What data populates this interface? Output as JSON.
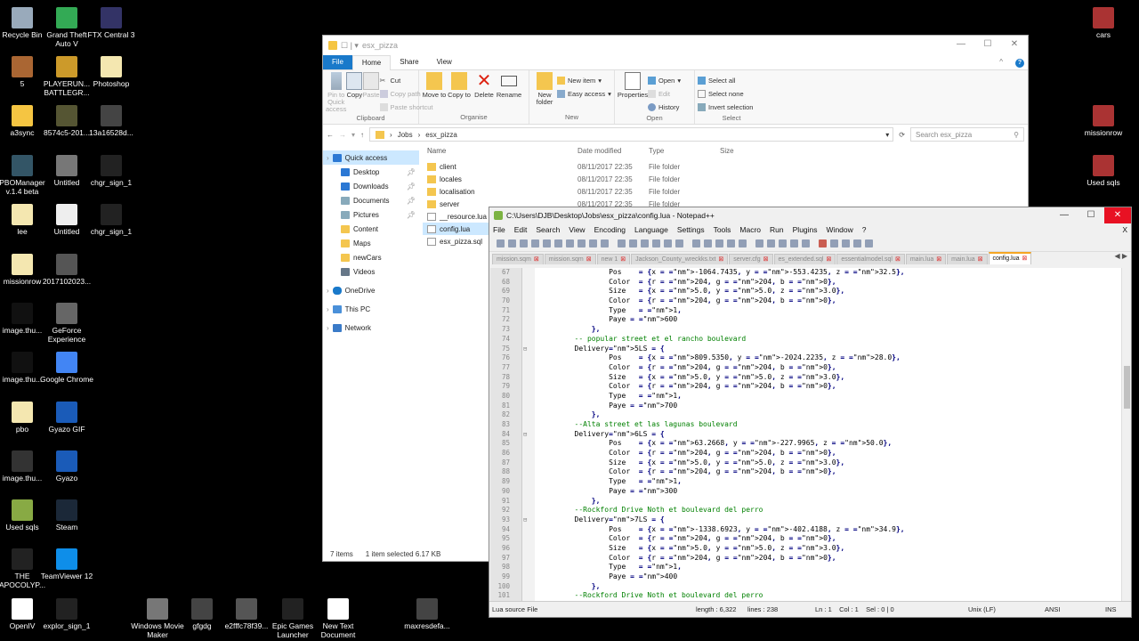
{
  "desktop": {
    "icons": [
      {
        "label": "Recycle Bin",
        "color": "#9ab"
      },
      {
        "label": "Grand Theft Auto V",
        "color": "#3a5"
      },
      {
        "label": "FTX Central 3",
        "color": "#336"
      },
      {
        "label": "cars",
        "color": "#a33"
      },
      {
        "label": "5",
        "color": "#a63"
      },
      {
        "label": "PLAYERUN... BATTLEGR...",
        "color": "#cc9a2a"
      },
      {
        "label": "Photoshop",
        "color": "#f4e7b0"
      },
      {
        "label": "a3sync",
        "color": "#f5c542"
      },
      {
        "label": "8574c5-201...",
        "color": "#553"
      },
      {
        "label": "13a16528d...",
        "color": "#444"
      },
      {
        "label": "missionrow",
        "color": "#a33"
      },
      {
        "label": "PBOManager v.1.4 beta",
        "color": "#356"
      },
      {
        "label": "Untitled",
        "color": "#777"
      },
      {
        "label": "chgr_sign_1",
        "color": "#222"
      },
      {
        "label": "Used sqls",
        "color": "#a33"
      },
      {
        "label": "lee",
        "color": "#f4e7b0"
      },
      {
        "label": "Untitled",
        "color": "#eee"
      },
      {
        "label": "chgr_sign_1",
        "color": "#222"
      },
      {
        "label": "missionrow",
        "color": "#f4e7b0"
      },
      {
        "label": "2017102023...",
        "color": "#555"
      },
      {
        "label": "image.thu...",
        "color": "#111"
      },
      {
        "label": "GeForce Experience",
        "color": "#666"
      },
      {
        "label": "image.thu...",
        "color": "#111"
      },
      {
        "label": "Google Chrome",
        "color": "#4285f4"
      },
      {
        "label": "pbo",
        "color": "#f4e7b0"
      },
      {
        "label": "Gyazo GIF",
        "color": "#1a5bb8"
      },
      {
        "label": "image.thu...",
        "color": "#333"
      },
      {
        "label": "Gyazo",
        "color": "#1a5bb8"
      },
      {
        "label": "Used sqls",
        "color": "#8a4"
      },
      {
        "label": "Steam",
        "color": "#1b2838"
      },
      {
        "label": "THE APOCOLYP...",
        "color": "#222"
      },
      {
        "label": "TeamViewer 12",
        "color": "#0e8ee9"
      },
      {
        "label": "OpenIV",
        "color": "#fff"
      },
      {
        "label": "explor_sign_1",
        "color": "#222"
      },
      {
        "label": "Windows Movie Maker",
        "color": "#777"
      },
      {
        "label": "gfgdg",
        "color": "#444"
      },
      {
        "label": "e2fffc78f39...",
        "color": "#555"
      },
      {
        "label": "Epic Games Launcher",
        "color": "#222"
      },
      {
        "label": "New Text Document",
        "color": "#fff"
      },
      {
        "label": "maxresdefa...",
        "color": "#444"
      }
    ]
  },
  "explorer": {
    "title": "esx_pizza",
    "tabs": [
      "File",
      "Home",
      "Share",
      "View"
    ],
    "ribbon": {
      "clipboard": {
        "name": "Clipboard",
        "pin": "Pin to Quick access",
        "copy": "Copy",
        "paste": "Paste",
        "cut": "Cut",
        "copy_path": "Copy path",
        "paste_shortcut": "Paste shortcut"
      },
      "organise": {
        "name": "Organise",
        "move_to": "Move to",
        "copy_to": "Copy to",
        "delete": "Delete",
        "rename": "Rename"
      },
      "new": {
        "name": "New",
        "new_folder": "New folder",
        "new_item": "New item",
        "easy_access": "Easy access"
      },
      "open": {
        "name": "Open",
        "properties": "Properties",
        "open": "Open",
        "edit": "Edit",
        "history": "History"
      },
      "select": {
        "name": "Select",
        "select_all": "Select all",
        "select_none": "Select none",
        "invert": "Invert selection"
      }
    },
    "address": {
      "crumb1": "Jobs",
      "crumb2": "esx_pizza",
      "search_placeholder": "Search esx_pizza"
    },
    "nav": [
      "Quick access",
      "Desktop",
      "Downloads",
      "Documents",
      "Pictures",
      "Content",
      "Maps",
      "newCars",
      "Videos",
      "OneDrive",
      "This PC",
      "Network"
    ],
    "columns": {
      "name": "Name",
      "date": "Date modified",
      "type": "Type",
      "size": "Size"
    },
    "files": [
      {
        "name": "client",
        "date": "08/11/2017 22:35",
        "type": "File folder",
        "kind": "folder"
      },
      {
        "name": "locales",
        "date": "08/11/2017 22:35",
        "type": "File folder",
        "kind": "folder"
      },
      {
        "name": "localisation",
        "date": "08/11/2017 22:35",
        "type": "File folder",
        "kind": "folder"
      },
      {
        "name": "server",
        "date": "08/11/2017 22:35",
        "type": "File folder",
        "kind": "folder"
      },
      {
        "name": "__resource.lua",
        "date": "",
        "type": "",
        "kind": "doc"
      },
      {
        "name": "config.lua",
        "date": "",
        "type": "",
        "kind": "doc"
      },
      {
        "name": "esx_pizza.sql",
        "date": "",
        "type": "",
        "kind": "doc"
      }
    ],
    "status": {
      "items": "7 items",
      "selected": "1 item selected  6.17 KB"
    }
  },
  "npp": {
    "title": "C:\\Users\\DJB\\Desktop\\Jobs\\esx_pizza\\config.lua - Notepad++",
    "menu": [
      "File",
      "Edit",
      "Search",
      "View",
      "Encoding",
      "Language",
      "Settings",
      "Tools",
      "Macro",
      "Run",
      "Plugins",
      "Window",
      "?"
    ],
    "tabs": [
      "mission.sqm",
      "mission.sqm",
      "new 1",
      "Jackson_County_wreckks.txt",
      "server.cfg",
      "es_extended.sql",
      "essentialmodel.sql",
      "main.lua",
      "main.lua",
      "config.lua"
    ],
    "status": {
      "filetype": "Lua source File",
      "length": "length : 6,322",
      "lines": "lines : 238",
      "pos": "Ln : 1    Col : 1    Sel : 0 | 0",
      "eol": "Unix (LF)",
      "enc": "ANSI",
      "mode": "INS"
    },
    "lines": [
      {
        "n": "67",
        "t": "                Pos    = {x = -1064.7435, y = -553.4235, z = 32.5},"
      },
      {
        "n": "68",
        "t": "                Color  = {r = 204, g = 204, b = 0},"
      },
      {
        "n": "69",
        "t": "                Size   = {x = 5.0, y = 5.0, z = 3.0},"
      },
      {
        "n": "70",
        "t": "                Color  = {r = 204, g = 204, b = 0},"
      },
      {
        "n": "71",
        "t": "                Type   = 1,"
      },
      {
        "n": "72",
        "t": "                Paye = 600"
      },
      {
        "n": "73",
        "t": "            },"
      },
      {
        "n": "74",
        "t": "        -- popular street et el rancho boulevard"
      },
      {
        "n": "75",
        "t": "        Delivery5LS = {",
        "f": "⊟"
      },
      {
        "n": "76",
        "t": "                Pos    = {x = 809.5350, y = -2024.2235, z = 28.0},"
      },
      {
        "n": "77",
        "t": "                Color  = {r = 204, g = 204, b = 0},"
      },
      {
        "n": "78",
        "t": "                Size   = {x = 5.0, y = 5.0, z = 3.0},"
      },
      {
        "n": "79",
        "t": "                Color  = {r = 204, g = 204, b = 0},"
      },
      {
        "n": "80",
        "t": "                Type   = 1,"
      },
      {
        "n": "81",
        "t": "                Paye = 700"
      },
      {
        "n": "82",
        "t": "            },"
      },
      {
        "n": "83",
        "t": "        --Alta street et las lagunas boulevard"
      },
      {
        "n": "84",
        "t": "        Delivery6LS = {",
        "f": "⊟"
      },
      {
        "n": "85",
        "t": "                Pos    = {x = 63.2668, y = -227.9965, z = 50.0},"
      },
      {
        "n": "86",
        "t": "                Color  = {r = 204, g = 204, b = 0},"
      },
      {
        "n": "87",
        "t": "                Size   = {x = 5.0, y = 5.0, z = 3.0},"
      },
      {
        "n": "88",
        "t": "                Color  = {r = 204, g = 204, b = 0},"
      },
      {
        "n": "89",
        "t": "                Type   = 1,"
      },
      {
        "n": "90",
        "t": "                Paye = 300"
      },
      {
        "n": "91",
        "t": "            },"
      },
      {
        "n": "92",
        "t": "        --Rockford Drive Noth et boulevard del perro"
      },
      {
        "n": "93",
        "t": "        Delivery7LS = {",
        "f": "⊟"
      },
      {
        "n": "94",
        "t": "                Pos    = {x = -1338.6923, y = -402.4188, z = 34.9},"
      },
      {
        "n": "95",
        "t": "                Color  = {r = 204, g = 204, b = 0},"
      },
      {
        "n": "96",
        "t": "                Size   = {x = 5.0, y = 5.0, z = 3.0},"
      },
      {
        "n": "97",
        "t": "                Color  = {r = 204, g = 204, b = 0},"
      },
      {
        "n": "98",
        "t": "                Type   = 1,"
      },
      {
        "n": "99",
        "t": "                Paye = 400"
      },
      {
        "n": "100",
        "t": "            },"
      },
      {
        "n": "101",
        "t": "        --Rockford Drive Noth et boulevard del perro"
      }
    ]
  }
}
